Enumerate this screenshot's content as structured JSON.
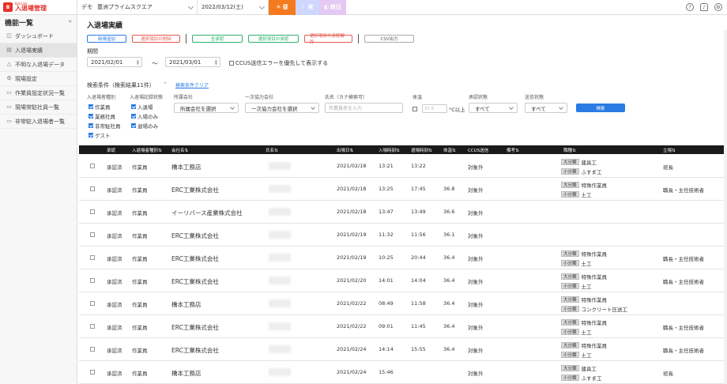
{
  "app": {
    "logo_small": "BuilLink",
    "logo_title": "入退場管理"
  },
  "topbar": {
    "org_label": "デモ",
    "site": "豊洲プライムスクエア",
    "date": "2022/03/12(土)",
    "weather": [
      "昼",
      "夜",
      "終日"
    ],
    "icons": [
      "help-icon",
      "bell-icon",
      "gear-icon"
    ]
  },
  "sidebar": {
    "title": "機能一覧",
    "collapse": "«",
    "items": [
      {
        "label": "ダッシュボード",
        "icon": "dashboard-icon"
      },
      {
        "label": "入退場実績",
        "icon": "list-icon",
        "active": true
      },
      {
        "label": "不明な入退場データ",
        "icon": "warning-icon"
      },
      {
        "label": "現場設定",
        "icon": "gear-icon"
      },
      {
        "label": "作業員設定状況一覧",
        "icon": "doc-icon"
      },
      {
        "label": "現場常駐社員一覧",
        "icon": "doc-icon"
      },
      {
        "label": "非常駐入退場者一覧",
        "icon": "doc-icon"
      }
    ]
  },
  "main": {
    "title": "入退場実績",
    "toolbar": {
      "new": "新規追加",
      "delete": "選択項目の削除",
      "approve_all": "全承認",
      "approve_selected": "選択項目の承認",
      "unapprove_selected": "選択項目の承認解除",
      "csv": "CSV出力"
    },
    "period": {
      "label": "期間",
      "from": "2021/02/01",
      "to": "2021/03/01",
      "tilde": "～",
      "ccus_priority": "CCUS送信エラーを優先して表示する"
    },
    "conditions": {
      "title": "検索条件（検索結果11件）",
      "clear": "検索条件クリア",
      "caret": "^",
      "entrant_type": {
        "label": "入退場者種別",
        "options": [
          "作業員",
          "業務社員",
          "非常駐社員",
          "ゲスト"
        ]
      },
      "record_state": {
        "label": "入退場記録状態",
        "options": [
          "入退場",
          "入場のみ",
          "退場のみ"
        ]
      },
      "company": {
        "label": "所属会社",
        "value": "所属会社を選択"
      },
      "primary": {
        "label": "一次協力会社",
        "value": "一次協力会社を選択"
      },
      "name": {
        "label": "氏名（カナ検索可）",
        "placeholder": "作業員名を入力"
      },
      "temp": {
        "label": "体温",
        "placeholder": "37.5",
        "suffix": "°C以上"
      },
      "approval": {
        "label": "承認状態",
        "value": "すべて"
      },
      "send": {
        "label": "送信状態",
        "value": "すべて"
      },
      "search": "検索"
    },
    "table": {
      "headers": [
        "承認",
        "入退場者種別⇅",
        "会社名⇅",
        "氏名⇅",
        "出場日⇅",
        "入場時刻⇅",
        "退場時刻⇅",
        "体温⇅",
        "CCUS送信",
        "備考⇅",
        "職種⇅",
        "立場⇅"
      ],
      "tag_major": "大分類",
      "tag_minor": "小分類",
      "rows": [
        {
          "approval": "承認済",
          "type": "作業員",
          "company": "橋本工務店",
          "date": "2021/02/18",
          "in": "13:21",
          "out": "13:22",
          "temp": "",
          "ccus": "対象外",
          "major": "建具工",
          "minor": "ふすま工",
          "role": "班長"
        },
        {
          "approval": "承認済",
          "type": "作業員",
          "company": "ERC工業株式会社",
          "date": "2021/02/18",
          "in": "13:25",
          "out": "17:45",
          "temp": "36.8",
          "ccus": "対象外",
          "major": "特殊作業員",
          "minor": "土工",
          "role": "職長・主任技術者"
        },
        {
          "approval": "承認済",
          "type": "作業員",
          "company": "イーリバース産業株式会社",
          "date": "2021/02/18",
          "in": "13:47",
          "out": "13:49",
          "temp": "36.6",
          "ccus": "対象外",
          "major": "",
          "minor": "",
          "role": ""
        },
        {
          "approval": "承認済",
          "type": "作業員",
          "company": "ERC工業株式会社",
          "date": "2021/02/19",
          "in": "11:32",
          "out": "11:56",
          "temp": "36.1",
          "ccus": "対象外",
          "major": "",
          "minor": "",
          "role": ""
        },
        {
          "approval": "承認済",
          "type": "作業員",
          "company": "ERC工業株式会社",
          "date": "2021/02/19",
          "in": "10:25",
          "out": "20:44",
          "temp": "36.4",
          "ccus": "対象外",
          "major": "特殊作業員",
          "minor": "土工",
          "role": "職長・主任技術者"
        },
        {
          "approval": "承認済",
          "type": "作業員",
          "company": "ERC工業株式会社",
          "date": "2021/02/20",
          "in": "14:01",
          "out": "14:04",
          "temp": "36.4",
          "ccus": "対象外",
          "major": "特殊作業員",
          "minor": "土工",
          "role": "職長・主任技術者"
        },
        {
          "approval": "承認済",
          "type": "作業員",
          "company": "橋本工務店",
          "date": "2021/02/22",
          "in": "08:49",
          "out": "11:58",
          "temp": "36.4",
          "ccus": "対象外",
          "major": "特殊作業員",
          "minor": "コンクリート圧送工",
          "role": ""
        },
        {
          "approval": "承認済",
          "type": "作業員",
          "company": "ERC工業株式会社",
          "date": "2021/02/22",
          "in": "09:01",
          "out": "11:45",
          "temp": "36.4",
          "ccus": "対象外",
          "major": "特殊作業員",
          "minor": "土工",
          "role": "職長・主任技術者"
        },
        {
          "approval": "承認済",
          "type": "作業員",
          "company": "ERC工業株式会社",
          "date": "2021/02/24",
          "in": "14:14",
          "out": "15:55",
          "temp": "36.4",
          "ccus": "対象外",
          "major": "特殊作業員",
          "minor": "土工",
          "role": "職長・主任技術者"
        },
        {
          "approval": "承認済",
          "type": "作業員",
          "company": "橋本工務店",
          "date": "2021/02/24",
          "in": "15:46",
          "out": "",
          "temp": "",
          "ccus": "対象外",
          "major": "建具工",
          "minor": "ふすま工",
          "role": "班長"
        }
      ]
    }
  },
  "colors": {
    "brand": "#e8302a",
    "accent": "#2b7be4",
    "header_bg": "#1a1a1a",
    "day": "#f57a1e",
    "night": "#cfd6ff",
    "all_day": "#e3c9f3"
  }
}
